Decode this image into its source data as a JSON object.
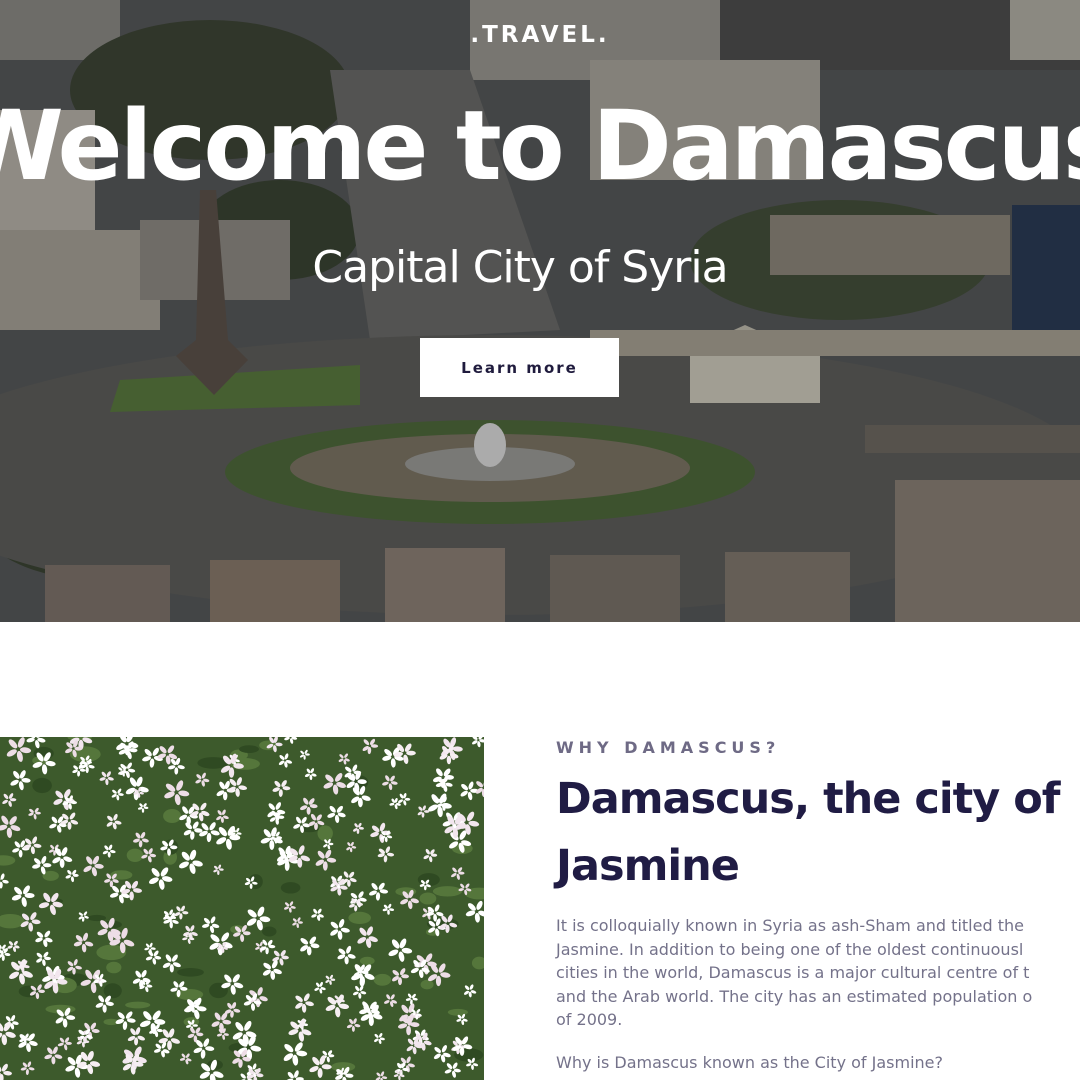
{
  "hero": {
    "brand": ".TRAVEL.",
    "title": "Welcome to Damascus",
    "subtitle": "Capital City of Syria",
    "cta_label": "Learn more"
  },
  "section": {
    "eyebrow": "WHY DAMASCUS?",
    "title_line1": "Damascus, the city of",
    "title_line2": "Jasmine",
    "paragraph_lines": [
      "It is colloquially known in Syria as ash-Sham and titled the",
      "Jasmine. In addition to being one of the oldest continuousl",
      "cities in the world, Damascus is a major cultural centre of t",
      "and the Arab world. The city has an estimated population o",
      "of 2009."
    ],
    "question": "Why is Damascus known as the City of Jasmine?"
  },
  "colors": {
    "heading": "#201c44",
    "eyebrow": "#6e6a85",
    "body_text": "#74728a",
    "button_bg": "#ffffff"
  }
}
